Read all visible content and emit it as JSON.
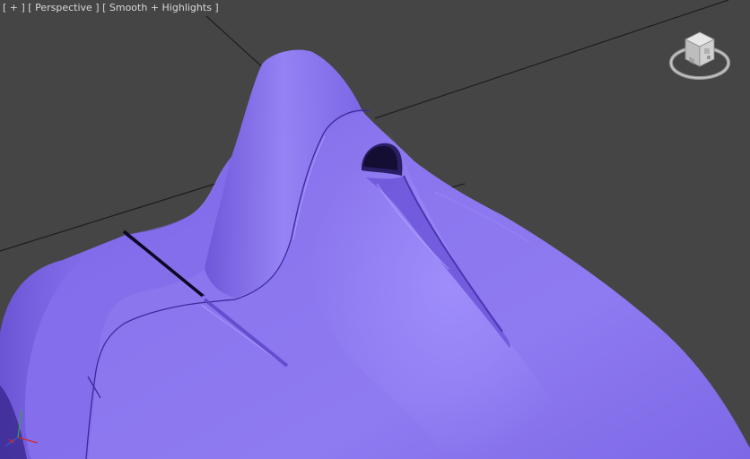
{
  "viewport": {
    "label_plus": "[ + ]",
    "label_view": "[ Perspective ]",
    "label_shading": "[ Smooth + Highlights ]"
  },
  "colors": {
    "background": "#454545",
    "grid_line": "#1e1e1e",
    "mesh": "#8a74ec",
    "mesh_shadow": "#5a45c0",
    "mesh_highlight": "#a597ff"
  },
  "icons": {
    "viewcube": "viewcube-icon",
    "axis_gizmo": "axis-tripod-icon"
  }
}
